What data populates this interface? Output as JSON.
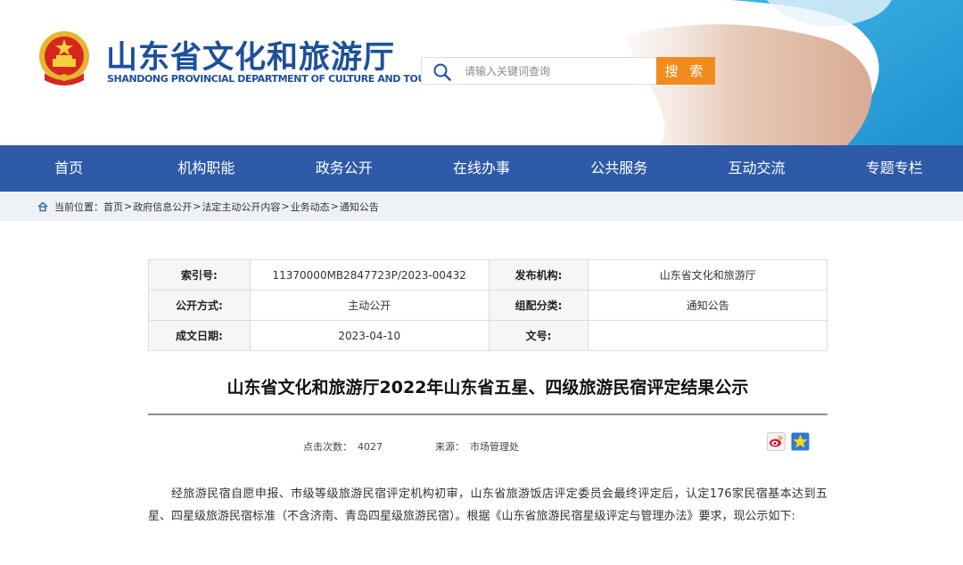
{
  "header": {
    "title": "山东省文化和旅游厅",
    "subtitle": "SHANDONG PROVINCIAL DEPARTMENT OF CULTURE AND TOURISM",
    "emblem_icon": "national-emblem-icon",
    "accent_color": "#1d4f9c"
  },
  "search": {
    "placeholder": "请输入关键词查询",
    "button_label": "搜 索",
    "button_color": "#f08c1e"
  },
  "nav": {
    "background": "#2e5aa8",
    "items": [
      "首页",
      "机构职能",
      "政务公开",
      "在线办事",
      "公共服务",
      "互动交流",
      "专题专栏"
    ]
  },
  "breadcrumb": {
    "prefix": "当前位置：",
    "items": [
      "首页",
      "政府信息公开",
      "法定主动公开内容",
      "业务动态",
      "通知公告"
    ],
    "separator": ">"
  },
  "meta": {
    "index_label": "索引号:",
    "index_value": "11370000MB2847723P/2023-00432",
    "publisher_label": "发布机构:",
    "publisher_value": "山东省文化和旅游厅",
    "disclosure_label": "公开方式:",
    "disclosure_value": "主动公开",
    "category_label": "组配分类:",
    "category_value": "通知公告",
    "date_label": "成文日期:",
    "date_value": "2023-04-10",
    "docno_label": "文号:",
    "docno_value": ""
  },
  "article": {
    "title": "山东省文化和旅游厅2022年山东省五星、四级旅游民宿评定结果公示",
    "clicks_label": "点击次数：",
    "clicks_value": "4027",
    "source_label": "来源：",
    "source_value": "市场管理处",
    "share_icons": [
      "weibo-icon",
      "favorite-star-icon"
    ],
    "body": "经旅游民宿自愿申报、市级等级旅游民宿评定机构初审，山东省旅游饭店评定委员会最终评定后，认定176家民宿基本达到五星、四星级旅游民宿标准（不含济南、青岛四星级旅游民宿）。根据《山东省旅游民宿星级评定与管理办法》要求，现公示如下:"
  }
}
